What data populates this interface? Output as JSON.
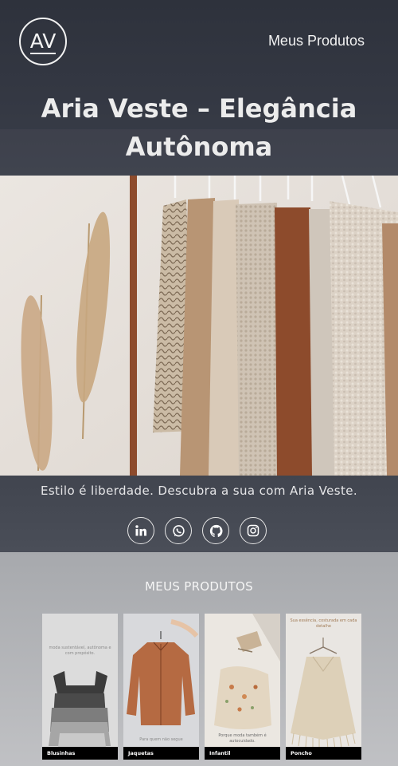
{
  "header": {
    "logo_text": "AV",
    "nav_link": "Meus Produtos",
    "title": "Aria Veste – Elegância Autônoma"
  },
  "hero": {
    "tagline": "Estilo é liberdade. Descubra a sua com Aria Veste."
  },
  "socials": [
    {
      "icon": "linkedin-icon"
    },
    {
      "icon": "whatsapp-icon"
    },
    {
      "icon": "github-icon"
    },
    {
      "icon": "instagram-icon"
    }
  ],
  "products": {
    "title": "MEUS PRODUTOS",
    "items": [
      {
        "label": "Blusinhas",
        "text": "moda sustentável, autônoma e com propósito."
      },
      {
        "label": "Jaquetas",
        "text": "Para quem não segue"
      },
      {
        "label": "Infantil",
        "text": "Porque moda também é autocuidado."
      },
      {
        "label": "Poncho",
        "text": "Sua essência, costurada em cada detalhe"
      }
    ]
  },
  "colors": {
    "header_bg": "#2f3440",
    "products_bg": "#b3b5b9",
    "caption_bg": "#000000"
  }
}
